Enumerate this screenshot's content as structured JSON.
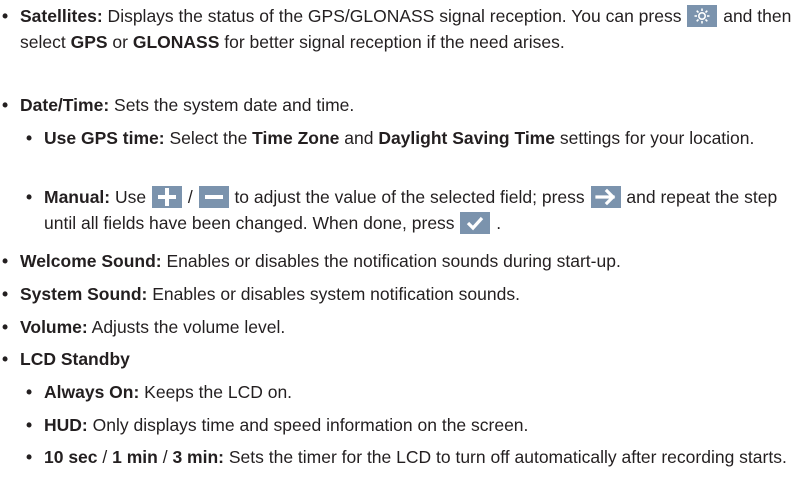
{
  "items": [
    {
      "label": "Satellites:",
      "text_a": " Displays the status of the GPS/GLONASS signal reception. You can press ",
      "icon": "gear-icon",
      "text_b": " and then select ",
      "opt_gps": "GPS",
      "text_c": " or ",
      "opt_glonass": "GLONASS",
      "text_d": " for better signal reception if the need arises."
    },
    {
      "label": "Date/Time:",
      "text": " Sets the system date and time.",
      "sub": [
        {
          "label": "Use GPS time:",
          "text_a": " Select the ",
          "b1": "Time Zone",
          "text_b": " and ",
          "b2": "Daylight Saving Time",
          "text_c": " settings for your location."
        },
        {
          "label": "Manual:",
          "text_a": " Use ",
          "icon_plus": "plus-icon",
          "slash": " / ",
          "icon_minus": "minus-icon",
          "text_b": " to adjust the value of the selected field; press ",
          "icon_next": "arrow-right-icon",
          "text_c": " and repeat the step until all fields have been changed. When done, press ",
          "icon_ok": "checkmark-icon",
          "text_d": " ."
        }
      ]
    },
    {
      "label": "Welcome Sound:",
      "text": " Enables or disables the notification sounds during start-up."
    },
    {
      "label": "System Sound:",
      "text": " Enables or disables system notification sounds."
    },
    {
      "label": "Volume:",
      "text": " Adjusts the volume level."
    },
    {
      "label": "LCD Standby",
      "sub": [
        {
          "label": "Always On:",
          "text": " Keeps the LCD on."
        },
        {
          "label": "HUD:",
          "text": " Only displays time and speed information on the screen."
        },
        {
          "label_a": "10 sec",
          "sep1": " / ",
          "label_b": "1 min",
          "sep2": " / ",
          "label_c": "3 min:",
          "text": " Sets the timer for the LCD to turn off automatically after recording starts."
        }
      ]
    }
  ],
  "bullet": "•",
  "icon_bg_color": "#7b93ad"
}
